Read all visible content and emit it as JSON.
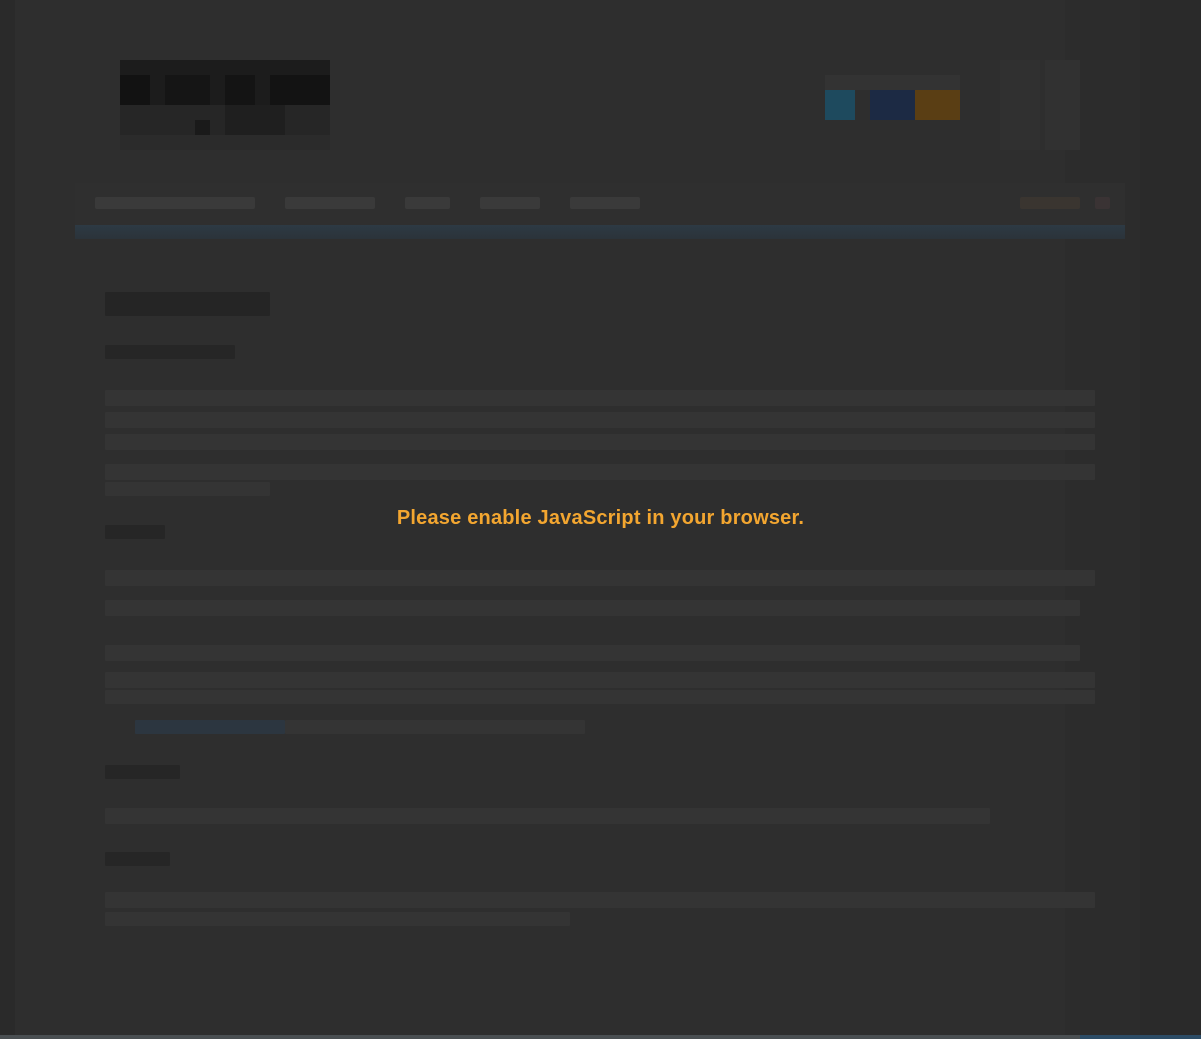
{
  "message": {
    "text": "Please enable JavaScript in your browser.",
    "color": "#f3a630"
  },
  "colors": {
    "background": "#2a2a2a",
    "page": "#2e2e2e",
    "nav_stripe": "#2d3a44",
    "social_blue": "#1e4a5e",
    "social_navy": "#1c2a44",
    "social_orange": "#5a3e14"
  }
}
